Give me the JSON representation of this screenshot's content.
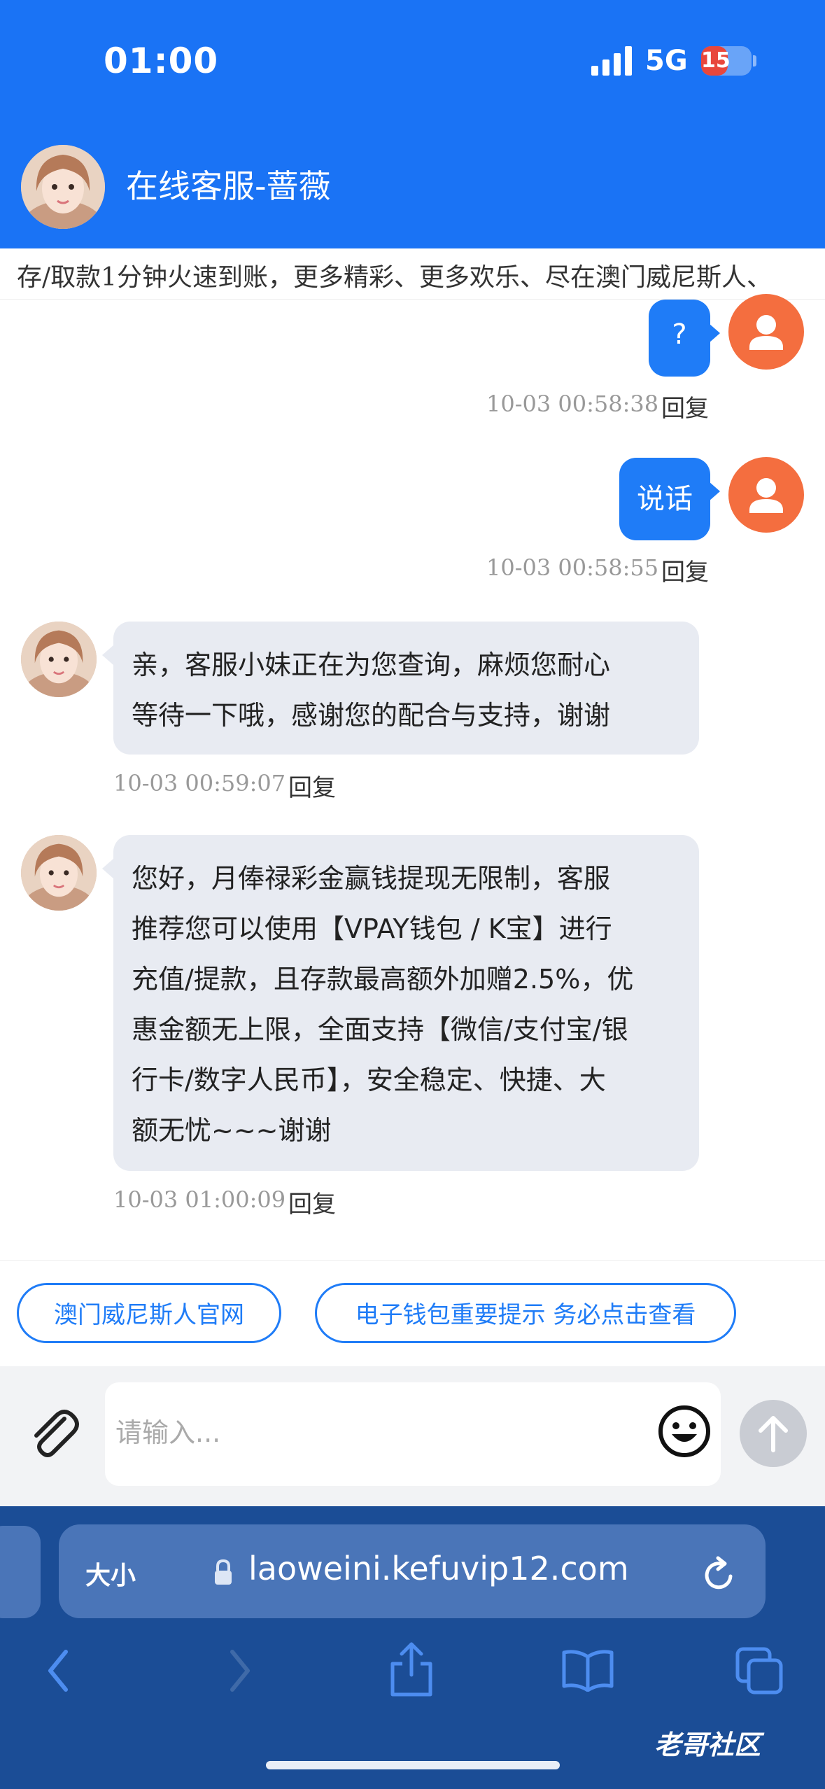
{
  "status_bar": {
    "time": "01:00",
    "network": "5G",
    "battery": "15",
    "battery_level_percent": 15
  },
  "header": {
    "title": "在线客服-蔷薇"
  },
  "marquee": {
    "text": "存/取款1分钟火速到账，更多精彩、更多欢乐、尽在澳门威尼斯人、"
  },
  "messages": [
    {
      "from": "me",
      "text": "?",
      "time": "10-03 00:58:38",
      "reply": "回复"
    },
    {
      "from": "me",
      "text": "说话",
      "time": "10-03 00:58:55",
      "reply": "回复"
    },
    {
      "from": "agent",
      "lines": [
        "亲，客服小妹正在为您查询，麻烦您耐心",
        "等待一下哦，感谢您的配合与支持，谢谢"
      ],
      "time": "10-03 00:59:07",
      "reply": "回复"
    },
    {
      "from": "agent",
      "lines": [
        "您好，月俸禄彩金赢钱提现无限制，客服",
        "推荐您可以使用【VPAY钱包 / K宝】进行",
        "充值/提款，且存款最高额外加赠2.5%，优",
        "惠金额无上限，全面支持【微信/支付宝/银",
        "行卡/数字人民币】，安全稳定、快捷、大",
        "额无忧~~~谢谢"
      ],
      "time": "10-03 01:00:09",
      "reply": "回复"
    }
  ],
  "quick_links": [
    "澳门威尼斯人官网",
    "电子钱包重要提示 务必点击查看"
  ],
  "input": {
    "placeholder": "请输入..."
  },
  "browser": {
    "size_label": "大小",
    "url": "laoweini.kefuvip12.com"
  },
  "watermark": {
    "text": "老哥社区"
  },
  "icons": {
    "attach": "paperclip-icon",
    "emoji": "emoji-icon",
    "send": "arrow-up-icon",
    "lock": "lock-icon",
    "reload": "reload-icon",
    "back": "chevron-left-icon",
    "forward": "chevron-right-icon",
    "share": "share-icon",
    "bookmarks": "book-icon",
    "tabs": "tabs-icon"
  },
  "colors": {
    "header_bg": "#1a73f5",
    "my_bubble": "#1f7cf7",
    "agent_bubble": "#e8ebf2",
    "user_avatar": "#f46e3f",
    "browser_bg": "#1b4d96"
  }
}
